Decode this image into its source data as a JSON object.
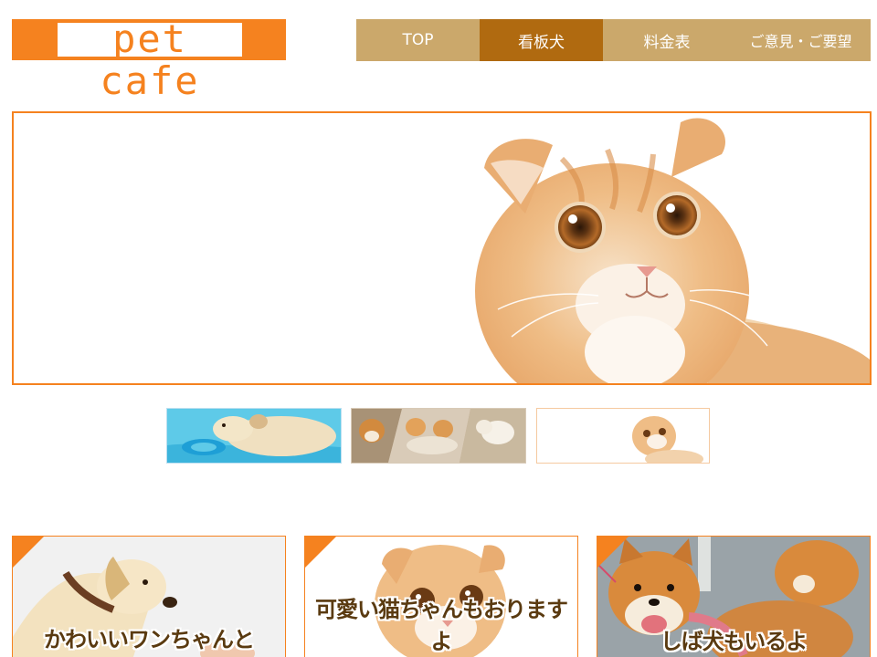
{
  "logo": {
    "text": "pet cafe"
  },
  "nav": {
    "items": [
      {
        "label": "TOP"
      },
      {
        "label": "看板犬",
        "active": true
      },
      {
        "label": "料金表"
      },
      {
        "label": "ご意見・ご要望"
      }
    ]
  },
  "hero": {
    "image": "scottish-fold-kitten-photo"
  },
  "thumbnails": [
    {
      "image": "labrador-frisbee-pool-photo"
    },
    {
      "image": "shiba-and-akita-dogs-collage-photo"
    },
    {
      "image": "scottish-fold-kitten-photo",
      "selected": true
    }
  ],
  "cards": [
    {
      "image": "labrador-paw-shake-photo",
      "caption": "かわいいワンちゃんと"
    },
    {
      "image": "orange-kitten-photo",
      "caption": "可愛い猫ちゃんもおりますよ"
    },
    {
      "image": "shiba-inu-photo",
      "caption": "しば犬もいるよ"
    }
  ],
  "colors": {
    "accent": "#f5821f",
    "nav_bg": "#cba86b",
    "nav_active": "#b06a10"
  }
}
